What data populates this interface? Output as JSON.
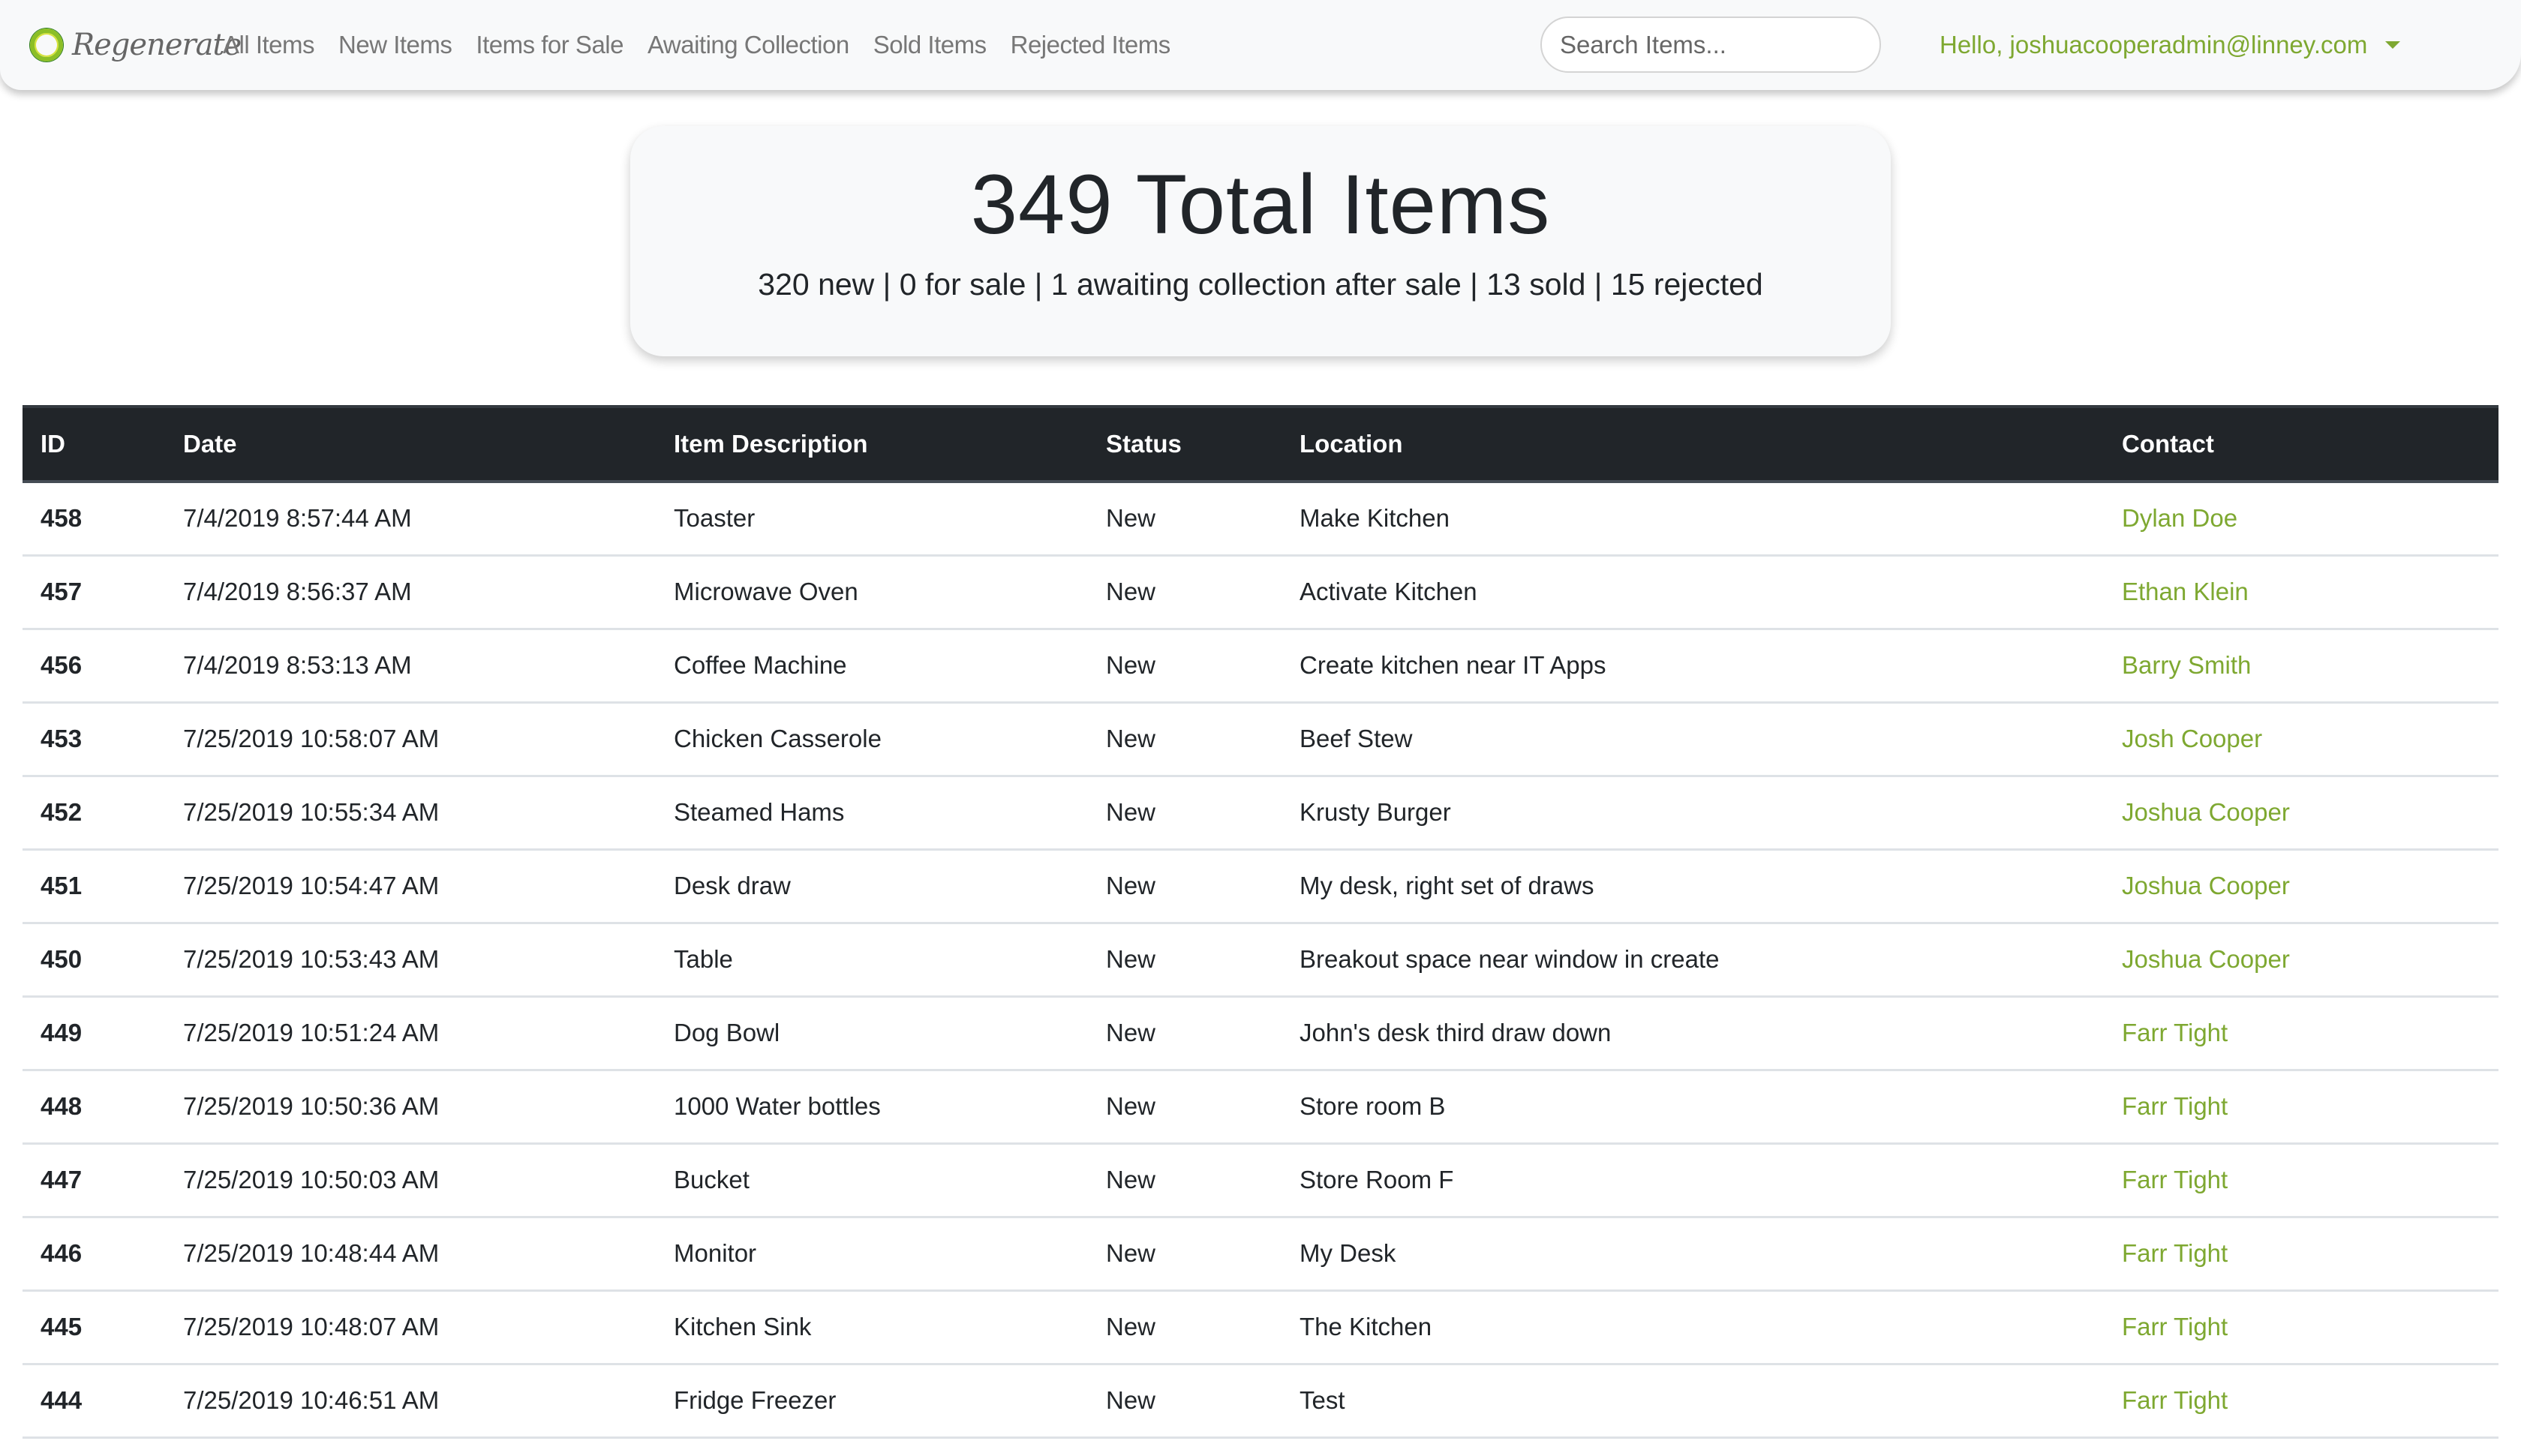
{
  "brand": {
    "name": "Regenerate",
    "logo_icon": "regenerate-ring-logo"
  },
  "nav": {
    "links": [
      {
        "label": "All Items"
      },
      {
        "label": "New Items"
      },
      {
        "label": "Items for Sale"
      },
      {
        "label": "Awaiting Collection"
      },
      {
        "label": "Sold Items"
      },
      {
        "label": "Rejected Items"
      }
    ],
    "search": {
      "placeholder": "Search Items...",
      "value": ""
    },
    "user_greeting": "Hello, joshuacooperadmin@linney.com",
    "user_menu_icon": "caret-down-icon"
  },
  "summary": {
    "title": "349 Total Items",
    "subtitle": "320 new | 0 for sale | 1 awaiting collection after sale | 13 sold | 15 rejected",
    "total": 349,
    "new": 320,
    "for_sale": 0,
    "awaiting_collection": 1,
    "sold": 13,
    "rejected": 15
  },
  "colors": {
    "accent": "#7ea831",
    "header_bg": "#212529",
    "navbar_bg": "#f8f9fa"
  },
  "table": {
    "headers": [
      "ID",
      "Date",
      "Item Description",
      "Status",
      "Location",
      "Contact"
    ],
    "rows": [
      {
        "id": "458",
        "date": "7/4/2019 8:57:44 AM",
        "description": "Toaster",
        "status": "New",
        "location": "Make Kitchen",
        "contact": "Dylan Doe"
      },
      {
        "id": "457",
        "date": "7/4/2019 8:56:37 AM",
        "description": "Microwave Oven",
        "status": "New",
        "location": "Activate Kitchen",
        "contact": "Ethan Klein"
      },
      {
        "id": "456",
        "date": "7/4/2019 8:53:13 AM",
        "description": "Coffee Machine",
        "status": "New",
        "location": "Create kitchen near IT Apps",
        "contact": "Barry Smith"
      },
      {
        "id": "453",
        "date": "7/25/2019 10:58:07 AM",
        "description": "Chicken Casserole",
        "status": "New",
        "location": "Beef Stew",
        "contact": "Josh Cooper"
      },
      {
        "id": "452",
        "date": "7/25/2019 10:55:34 AM",
        "description": "Steamed Hams",
        "status": "New",
        "location": "Krusty Burger",
        "contact": "Joshua Cooper"
      },
      {
        "id": "451",
        "date": "7/25/2019 10:54:47 AM",
        "description": "Desk draw",
        "status": "New",
        "location": "My desk, right set of draws",
        "contact": "Joshua Cooper"
      },
      {
        "id": "450",
        "date": "7/25/2019 10:53:43 AM",
        "description": "Table",
        "status": "New",
        "location": "Breakout space near window in create",
        "contact": "Joshua Cooper"
      },
      {
        "id": "449",
        "date": "7/25/2019 10:51:24 AM",
        "description": "Dog Bowl",
        "status": "New",
        "location": "John's desk third draw down",
        "contact": "Farr Tight"
      },
      {
        "id": "448",
        "date": "7/25/2019 10:50:36 AM",
        "description": "1000 Water bottles",
        "status": "New",
        "location": "Store room B",
        "contact": "Farr Tight"
      },
      {
        "id": "447",
        "date": "7/25/2019 10:50:03 AM",
        "description": "Bucket",
        "status": "New",
        "location": "Store Room F",
        "contact": "Farr Tight"
      },
      {
        "id": "446",
        "date": "7/25/2019 10:48:44 AM",
        "description": "Monitor",
        "status": "New",
        "location": "My Desk",
        "contact": "Farr Tight"
      },
      {
        "id": "445",
        "date": "7/25/2019 10:48:07 AM",
        "description": "Kitchen Sink",
        "status": "New",
        "location": "The Kitchen",
        "contact": "Farr Tight"
      },
      {
        "id": "444",
        "date": "7/25/2019 10:46:51 AM",
        "description": "Fridge Freezer",
        "status": "New",
        "location": "Test",
        "contact": "Farr Tight"
      }
    ]
  }
}
